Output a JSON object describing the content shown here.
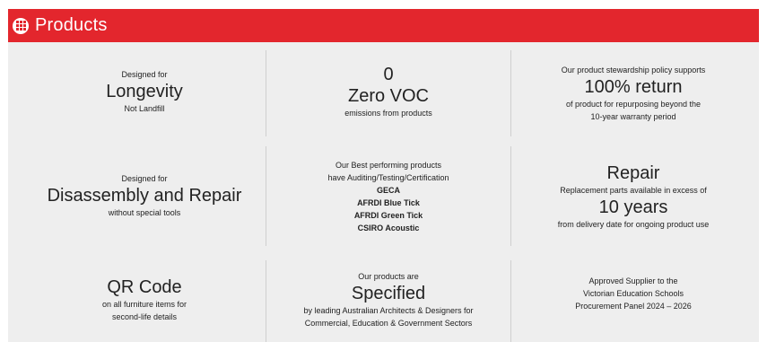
{
  "header": {
    "icon": "grid-icon",
    "title": "Products",
    "color": "#e3262d"
  },
  "cells": [
    {
      "pre": "Designed for",
      "big": "Longevity",
      "post": [
        "Not Landfill"
      ]
    },
    {
      "big1": "0",
      "big2": "Zero VOC",
      "post": [
        "emissions from products"
      ]
    },
    {
      "pre": [
        "Our product stewardship policy supports"
      ],
      "big": "100% return",
      "post": [
        "of product for repurposing beyond the",
        "10-year warranty period"
      ]
    },
    {
      "pre": "Designed for",
      "big": "Disassembly and Repair",
      "post": [
        "without special tools"
      ]
    },
    {
      "lines": [
        "Our Best performing products",
        "have Auditing/Testing/Certification"
      ],
      "bold": [
        "GECA",
        "AFRDI Blue Tick",
        "AFRDI Green Tick",
        "CSIRO Acoustic"
      ]
    },
    {
      "big1": "Repair",
      "mid": "Replacement parts available in excess of",
      "big2": "10 years",
      "post": [
        "from delivery date for ongoing product use"
      ]
    },
    {
      "big": "QR Code",
      "post": [
        "on all furniture items for",
        "second-life details"
      ]
    },
    {
      "pre": "Our products are",
      "big": "Specified",
      "post": [
        "by leading Australian Architects & Designers for",
        "Commercial, Education & Government Sectors"
      ]
    },
    {
      "lines": [
        "Approved Supplier to the",
        "Victorian Education Schools",
        "Procurement Panel 2024 – 2026"
      ]
    }
  ]
}
